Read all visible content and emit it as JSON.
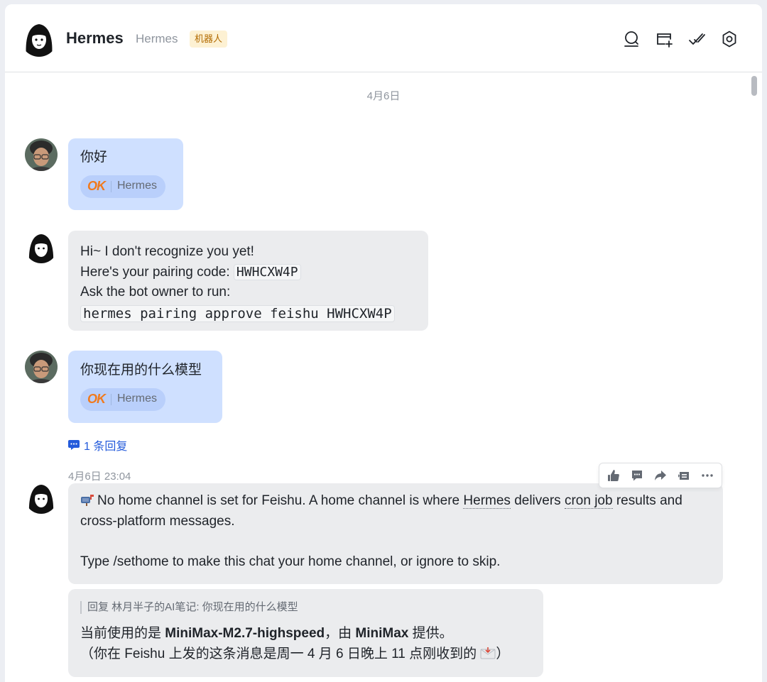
{
  "header": {
    "title": "Hermes",
    "subtitle": "Hermes",
    "badge": "机器人",
    "icons": [
      "search-icon",
      "add-tab-icon",
      "mark-done-icon",
      "settings-icon"
    ]
  },
  "chat": {
    "date_separator": "4月6日",
    "messages": [
      {
        "sender": "user",
        "text": "你好",
        "reaction": {
          "emoji": "OK",
          "by": "Hermes"
        }
      },
      {
        "sender": "bot",
        "line1": "Hi~ I don't recognize you yet!",
        "line2_prefix": "Here's your pairing code:",
        "pairing_code": "HWHCXW4P",
        "line3": "Ask the bot owner to run:",
        "command": "hermes pairing approve feishu HWHCXW4P"
      },
      {
        "sender": "user",
        "text": "你现在用的什么模型",
        "reaction": {
          "emoji": "OK",
          "by": "Hermes"
        }
      },
      {
        "sender": "bot",
        "timestamp": "4月6日 23:04",
        "icon": "mailbox-icon",
        "p1_a": "No home channel is set for Feishu. A home channel is where ",
        "p1_link1": "Hermes",
        "p1_b": " delivers ",
        "p1_link2": "cron job",
        "p1_c": " results and cross-platform messages.",
        "p2": "Type /sethome to make this chat your home channel, or ignore to skip."
      },
      {
        "sender": "bot",
        "quote": "回复 林月半子的AI笔记: 你现在用的什么模型",
        "line1_a": "当前使用的是 ",
        "model": "MiniMax-M2.7-highspeed",
        "line1_b": "，由 ",
        "provider": "MiniMax",
        "line1_c": " 提供。",
        "line2": "（你在 Feishu 上发的这条消息是周一 4 月 6 日晚上 11 点刚收到的 ",
        "line2_end": "）"
      }
    ],
    "thread_link": "1 条回复",
    "toolbar_icons": [
      "thumbs-up-icon",
      "comment-icon",
      "forward-icon",
      "quote-reply-icon",
      "more-icon"
    ]
  },
  "colors": {
    "user_bubble": "#cfe0ff",
    "bot_bubble": "#ebecee",
    "link_blue": "#245bdb",
    "badge_bg": "#fdf1d3",
    "badge_text": "#b26a00"
  }
}
